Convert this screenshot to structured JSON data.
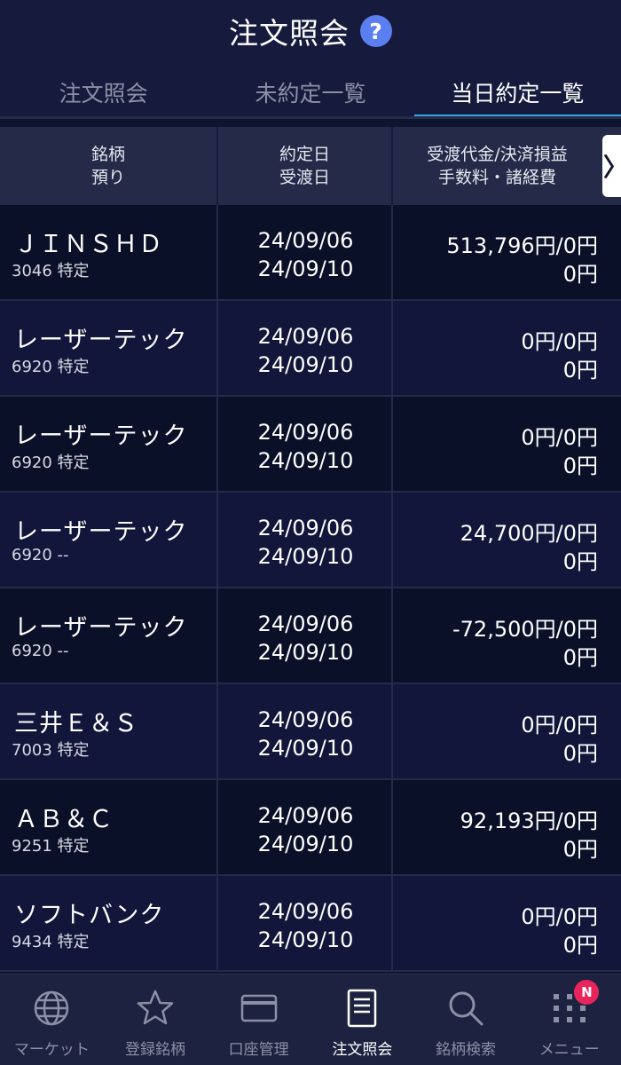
{
  "header": {
    "title": "注文照会",
    "help_icon": "?"
  },
  "tabs": [
    {
      "label": "注文照会",
      "active": false
    },
    {
      "label": "未約定一覧",
      "active": false
    },
    {
      "label": "当日約定一覧",
      "active": true
    }
  ],
  "table_header": {
    "col1_line1": "銘柄",
    "col1_line2": "預り",
    "col2_line1": "約定日",
    "col2_line2": "受渡日",
    "col3_line1": "受渡代金/決済損益",
    "col3_line2": "手数料・諸経費",
    "scroll_right": "〉"
  },
  "rows": [
    {
      "name": "ＪＩＮＳＨＤ",
      "sub": "3046 特定",
      "trade_date": "24/09/06",
      "settle_date": "24/09/10",
      "amount": "513,796円/0円",
      "fee": "0円"
    },
    {
      "name": "レーザーテック",
      "sub": "6920 特定",
      "trade_date": "24/09/06",
      "settle_date": "24/09/10",
      "amount": "0円/0円",
      "fee": "0円"
    },
    {
      "name": "レーザーテック",
      "sub": "6920 特定",
      "trade_date": "24/09/06",
      "settle_date": "24/09/10",
      "amount": "0円/0円",
      "fee": "0円"
    },
    {
      "name": "レーザーテック",
      "sub": "6920 --",
      "trade_date": "24/09/06",
      "settle_date": "24/09/10",
      "amount": "24,700円/0円",
      "fee": "0円"
    },
    {
      "name": "レーザーテック",
      "sub": "6920 --",
      "trade_date": "24/09/06",
      "settle_date": "24/09/10",
      "amount": "-72,500円/0円",
      "fee": "0円"
    },
    {
      "name": "三井Ｅ＆Ｓ",
      "sub": "7003 特定",
      "trade_date": "24/09/06",
      "settle_date": "24/09/10",
      "amount": "0円/0円",
      "fee": "0円"
    },
    {
      "name": "ＡＢ＆Ｃ",
      "sub": "9251 特定",
      "trade_date": "24/09/06",
      "settle_date": "24/09/10",
      "amount": "92,193円/0円",
      "fee": "0円"
    },
    {
      "name": "ソフトバンク",
      "sub": "9434 特定",
      "trade_date": "24/09/06",
      "settle_date": "24/09/10",
      "amount": "0円/0円",
      "fee": "0円"
    }
  ],
  "bottom_nav": [
    {
      "label": "マーケット",
      "icon": "globe-icon",
      "active": false
    },
    {
      "label": "登録銘柄",
      "icon": "star-icon",
      "active": false
    },
    {
      "label": "口座管理",
      "icon": "card-icon",
      "active": false
    },
    {
      "label": "注文照会",
      "icon": "document-icon",
      "active": true
    },
    {
      "label": "銘柄検索",
      "icon": "search-icon",
      "active": false
    },
    {
      "label": "メニュー",
      "icon": "grid-menu-icon",
      "active": false,
      "badge": "N"
    }
  ],
  "colors": {
    "accent": "#2fa6e6",
    "help": "#5b7ff0",
    "badge": "#e8245b"
  }
}
